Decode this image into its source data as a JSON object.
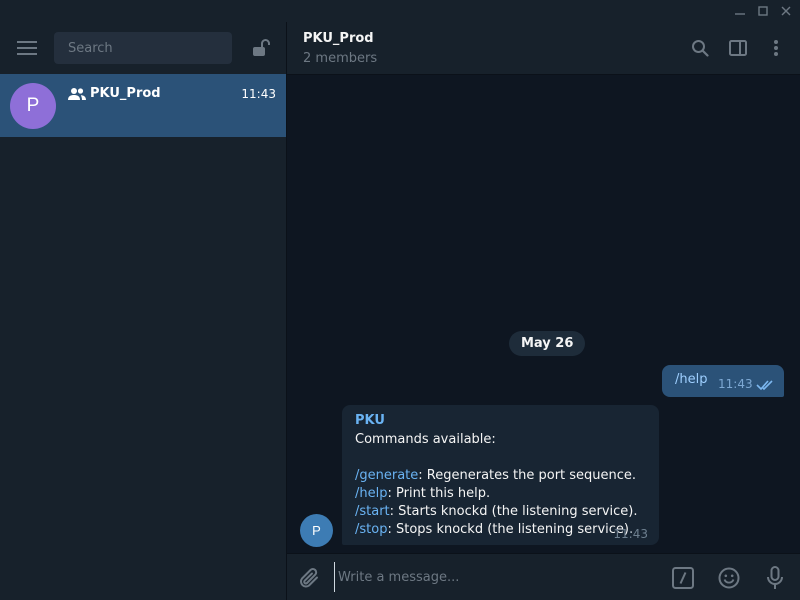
{
  "sidebar": {
    "search_placeholder": "Search",
    "chats": [
      {
        "avatar_letter": "P",
        "name": "PKU_Prod",
        "time": "11:43"
      }
    ]
  },
  "header": {
    "title": "PKU_Prod",
    "subtitle": "2 members"
  },
  "messages": {
    "date_label": "May 26",
    "outgoing": {
      "text": "/help",
      "time": "11:43"
    },
    "incoming": {
      "avatar_letter": "P",
      "sender": "PKU",
      "intro": "Commands available:",
      "commands": [
        {
          "cmd": "/generate",
          "desc": ": Regenerates the port sequence."
        },
        {
          "cmd": "/help",
          "desc": ": Print this help."
        },
        {
          "cmd": "/start",
          "desc": ": Starts knockd (the listening service)."
        },
        {
          "cmd": "/stop",
          "desc": ": Stops knockd (the listening service)."
        }
      ],
      "time": "11:43"
    }
  },
  "composer": {
    "placeholder": "Write a message..."
  },
  "icons": {
    "titlebar": [
      "minimize-icon",
      "maximize-icon",
      "close-icon"
    ],
    "sidebar": [
      "menu-icon",
      "unlock-icon",
      "group-icon"
    ],
    "header": [
      "search-icon",
      "sidebar-toggle-icon",
      "more-vertical-icon"
    ],
    "message": [
      "double-check-icon"
    ],
    "composer": [
      "attach-icon",
      "bot-command-icon",
      "emoji-icon",
      "microphone-icon"
    ]
  },
  "colors": {
    "accent": "#2b5278",
    "link": "#6ab3f3",
    "background": "#0e1621",
    "panel": "#17212b",
    "avatar_chat": "#8e6fd8",
    "avatar_sender": "#3d7cb4"
  }
}
